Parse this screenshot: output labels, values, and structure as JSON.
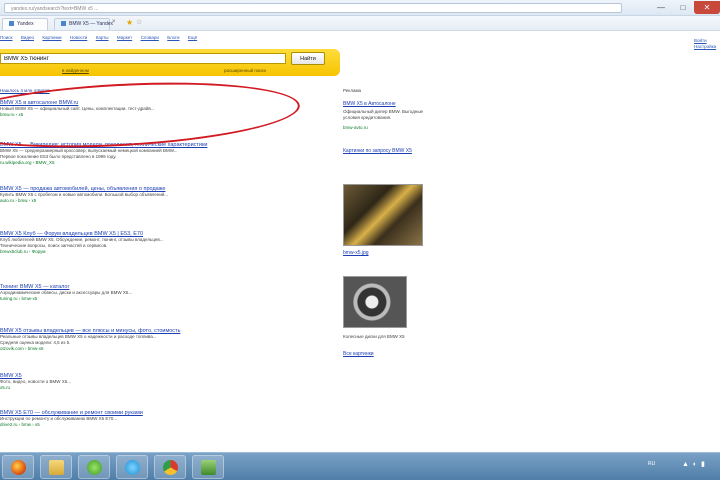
{
  "browser": {
    "url": "yandex.ru/yandsearch?text=BMW x5 ...",
    "tabs": [
      {
        "label": "Yandex"
      },
      {
        "label": "BMW X5 — Yandex"
      }
    ],
    "tab_close": "×",
    "fav_icon": "★",
    "fav_star": "☆",
    "window": {
      "minimize": "—",
      "maximize": "□",
      "close": "✕"
    }
  },
  "services": [
    "Поиск",
    "Видео",
    "Картинки",
    "Новости",
    "Карты",
    "Маркет",
    "Словари",
    "Блоги",
    "Ещё"
  ],
  "top_right": {
    "lines": [
      "Войти",
      "Настройка"
    ]
  },
  "search": {
    "query": "BMW X5 тюнинг",
    "button_label": "Найти",
    "region_link": "в найденном",
    "advanced_link": "расширенный поиск"
  },
  "results_found": "Нашлось 4 млн ответов",
  "results": [
    {
      "title": "BMW X5 в автосалоне BMW.ru",
      "snippet": [
        "Новый BMW X5 — официальный сайт. Цены, комплектации, тест-драйв..."
      ],
      "url": "bmw.ru › x5"
    },
    {
      "title": "BMW X5 — Википедия: история модели, поколения, технические характеристики",
      "snippet": [
        "BMW X5 — среднеразмерный кроссовер, выпускаемый немецкой компанией BMW...",
        "Первое поколение E53 было представлено в 1999 году."
      ],
      "url": "ru.wikipedia.org › BMW_X5"
    },
    {
      "title": "BMW X5 — продажа автомобилей, цены, объявления о продаже",
      "snippet": [
        "Купить BMW X5 с пробегом и новые автомобили. Большой выбор объявлений..."
      ],
      "url": "auto.ru › bmw › x5"
    },
    {
      "title": "BMW X5 Клуб — Форум владельцев BMW X5 | E53, E70",
      "snippet": [
        "Клуб любителей BMW X5. Обсуждение, ремонт, тюнинг, отзывы владельцев...",
        "Технические вопросы, поиск запчастей и сервисов."
      ],
      "url": "bmwx5club.ru › Форум"
    },
    {
      "title": "Тюнинг BMW X5 — каталог",
      "snippet": [
        "Аэродинамические обвесы, диски и аксессуары для BMW X5..."
      ],
      "url": "tuning.ru › bmw-x5"
    },
    {
      "title": "BMW X5 отзывы владельцев — все плюсы и минусы, фото, стоимость",
      "snippet": [
        "Реальные отзывы владельцев BMW X5 о надежности и расходе топлива...",
        "Средняя оценка модели: 4,5 из 5."
      ],
      "url": "otzovik.com › bmw-x5"
    },
    {
      "title": "BMW X5",
      "snippet": [
        "Фото, видео, новости о BMW X5..."
      ],
      "url": "x5.ru"
    },
    {
      "title": "BMW X5 E70 — обслуживание и ремонт своими руками",
      "snippet": [
        "Инструкции по ремонту и обслуживанию BMW X5 E70..."
      ],
      "url": "drive2.ru › bmw › x5"
    }
  ],
  "right_column": {
    "label": "Реклама",
    "ad_title": "BMW X5 в Автосалоне",
    "ad_text": [
      "Официальный дилер BMW. Выгодные",
      "условия кредитования."
    ],
    "ad_url": "bmw-avto.ru",
    "images_link": "Картинки по запросу BMW X5",
    "photo1_caption": "bmw-x5.jpg",
    "photo2_caption_link": "Диски BMW X5",
    "photo2_text": "Колесные диски для BMW X5",
    "photo2_source": "Все картинки"
  },
  "taskbar": {
    "apps": [
      "firefox-icon",
      "explorer-icon",
      "utorrent-icon",
      "skype-icon",
      "chrome-icon",
      "app-icon"
    ],
    "lang": "RU",
    "tray": "▲ ◐ ▮"
  },
  "colors": {
    "search_bar": "#f6c400",
    "link": "#1d3fb4",
    "url_green": "#0a7a2a",
    "highlight": "#d11a22",
    "taskbar": "#5a86ae"
  }
}
